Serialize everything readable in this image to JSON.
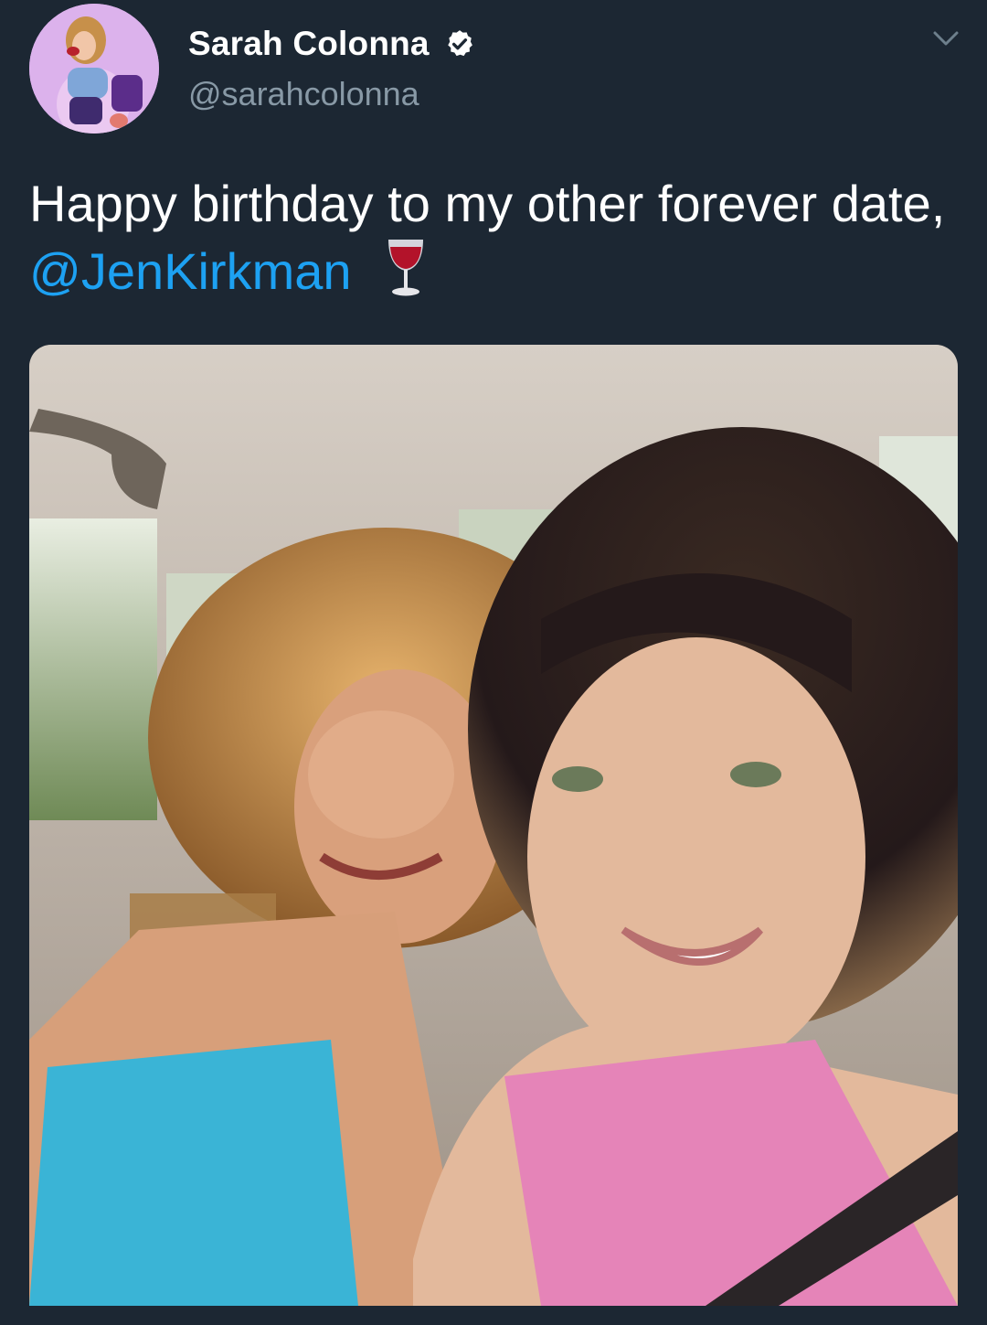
{
  "tweet": {
    "author": {
      "display_name": "Sarah Colonna",
      "handle": "@sarahcolonna",
      "verified": true,
      "avatar_icon": "avatar-photo"
    },
    "text_before": "Happy birthday to my other forever date, ",
    "mention": "@JenKirkman",
    "emoji": "wine-glass-icon",
    "menu_icon": "chevron-down-icon",
    "media": {
      "type": "photo"
    }
  },
  "colors": {
    "background": "#1c2733",
    "text": "#ffffff",
    "secondary_text": "#8899a6",
    "link": "#1da1f2",
    "verified_badge": "#ffffff"
  }
}
